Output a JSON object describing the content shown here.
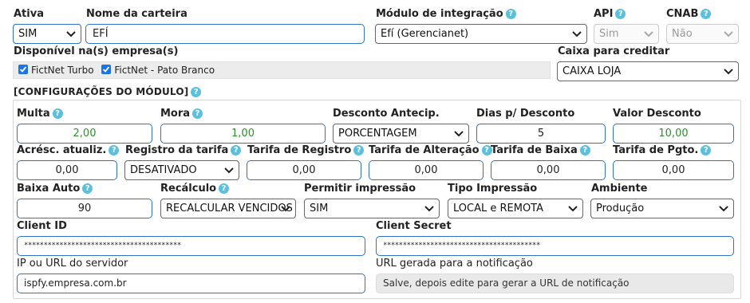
{
  "header": {
    "ativa": {
      "label": "Ativa",
      "value": "SIM"
    },
    "nome_carteira": {
      "label": "Nome da carteira",
      "value": "EFÍ"
    },
    "modulo_integracao": {
      "label": "Módulo de integração",
      "value": "Efí (Gerencianet)"
    },
    "api": {
      "label": "API",
      "value": "Sim"
    },
    "cnab": {
      "label": "CNAB",
      "value": "Não"
    }
  },
  "empresas": {
    "label": "Disponível na(s) empresa(s)",
    "items": [
      {
        "label": "FictNet Turbo",
        "checked": true
      },
      {
        "label": "FictNet - Pato Branco",
        "checked": true
      }
    ]
  },
  "caixa": {
    "label": "Caixa para creditar",
    "value": "CAIXA LOJA"
  },
  "section": {
    "title": "[CONFIGURAÇÕES DO MÓDULO]",
    "multa": {
      "label": "Multa",
      "value": "2,00"
    },
    "mora": {
      "label": "Mora",
      "value": "1,00"
    },
    "desconto_antecip": {
      "label": "Desconto Antecip.",
      "value": "PORCENTAGEM"
    },
    "dias_desconto": {
      "label": "Dias p/ Desconto",
      "value": "5"
    },
    "valor_desconto": {
      "label": "Valor Desconto",
      "value": "10,00"
    },
    "acresc_atualiz": {
      "label": "Acrésc. atualiz.",
      "value": "0,00"
    },
    "registro_tarifa": {
      "label": "Registro da tarifa",
      "value": "DESATIVADO"
    },
    "tarifa_registro": {
      "label": "Tarifa de Registro",
      "value": "0,00"
    },
    "tarifa_alteracao": {
      "label": "Tarifa de Alteração",
      "value": "0,00"
    },
    "tarifa_baixa": {
      "label": "Tarifa de Baixa",
      "value": "0,00"
    },
    "tarifa_pgto": {
      "label": "Tarifa de Pgto.",
      "value": "0,00"
    },
    "baixa_auto": {
      "label": "Baixa Auto",
      "value": "90"
    },
    "recalculo": {
      "label": "Recálculo",
      "value": "RECALCULAR VENCIDOS"
    },
    "permitir_impressao": {
      "label": "Permitir impressão",
      "value": "SIM"
    },
    "tipo_impressao": {
      "label": "Tipo Impressão",
      "value": "LOCAL e REMOTA"
    },
    "ambiente": {
      "label": "Ambiente",
      "value": "Produção"
    },
    "client_id": {
      "label": "Client ID",
      "value": "****************************************"
    },
    "client_secret": {
      "label": "Client Secret",
      "value": "****************************************"
    },
    "ip_url": {
      "label": "IP ou URL do servidor",
      "value": "ispfy.empresa.com.br"
    },
    "url_notificacao": {
      "label": "URL gerada para a notificação",
      "value": "Salve, depois edite para gerar a URL de notificação"
    }
  },
  "icons": {
    "help": "help-icon",
    "dropdown": "chevron-down-icon",
    "checkbox": "checkbox-checked-icon"
  },
  "colors": {
    "accent": "#2c73c8",
    "help": "#5bc0de",
    "value_green": "#2f8f2f",
    "checkbox": "#1a73e8"
  }
}
